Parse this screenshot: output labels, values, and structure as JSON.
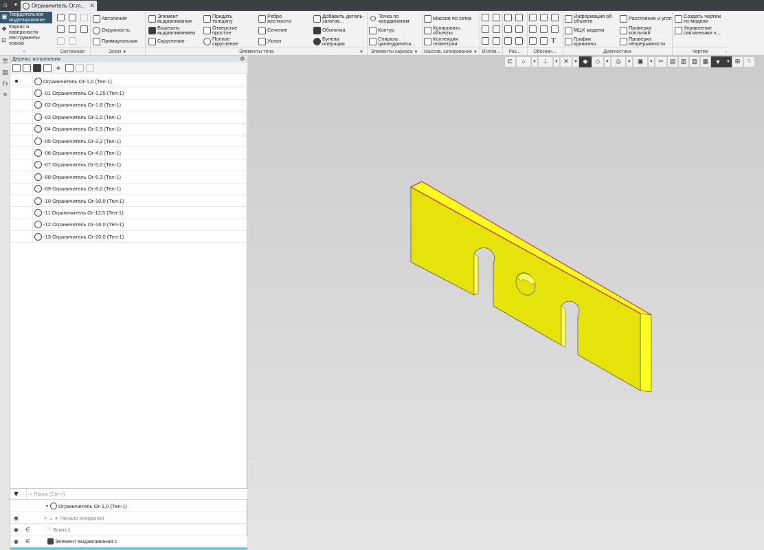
{
  "tab_bar": {
    "home_icon": "home-icon",
    "document_tab": {
      "title": "Ограничитель Ог.m...",
      "close": "✕"
    }
  },
  "ribbon": {
    "modes": [
      {
        "label": "Твердотельное моделирование",
        "icon": "solid-modeling-icon",
        "active": true
      },
      {
        "label": "Каркас и поверхности",
        "icon": "wireframe-icon",
        "active": false
      },
      {
        "label": "Инструменты эскиза",
        "icon": "sketch-tools-icon",
        "active": false
      }
    ],
    "groups": {
      "system": "Системная",
      "sketch": "Эскиз",
      "body_elements": "Элементы тела",
      "frame_elements": "Элементы каркаса",
      "arrays": "Массив, копирование",
      "aux": "Вспом...",
      "sizes": "Раз...",
      "designations": "Обознач...",
      "diagnostics": "Диагностика",
      "drawing": "Чертеж"
    },
    "sketch_buttons": [
      "Автолиния",
      "Окружность",
      "Прямоугольник"
    ],
    "body_buttons": [
      "Элемент выдавливания",
      "Вырезать выдавливанием",
      "Скругление",
      "Придать толщину",
      "Отверстие простое",
      "Полное скругление",
      "Ребро жесткости",
      "Сечение",
      "Уклон",
      "Добавить деталь-заготов...",
      "Оболочка",
      "Булева операция"
    ],
    "frame_buttons": [
      "Точка по координатам",
      "Контур",
      "Спираль цилиндрическ..."
    ],
    "array_buttons": [
      "Массив по сетке",
      "Копировать объекты",
      "Коллекция геометрии"
    ],
    "diagnostic_buttons": [
      "Информация об объекте",
      "МЦХ модели",
      "График кривизны",
      "Расстояние и угол",
      "Проверка коллизий",
      "Проверка непрерывности"
    ],
    "drawing_buttons": [
      "Создать чертеж по модели",
      "Управление связанными ч..."
    ]
  },
  "panel": {
    "title": "Дерево: исполнения",
    "search_placeholder": "Поиск (Ctrl+/)",
    "variants": [
      {
        "label": "Ограничитель Ог-1,0 (Тел-1)",
        "current": true
      },
      {
        "label": "-01 Ограничитель Ог-1,25 (Тел-1)",
        "current": false
      },
      {
        "label": "-02 Ограничитель Ог-1,6 (Тел-1)",
        "current": false
      },
      {
        "label": "-03 Ограничитель Ог-2,0 (Тел-1)",
        "current": false
      },
      {
        "label": "-04 Ограничитель Ог-2,5 (Тел-1)",
        "current": false
      },
      {
        "label": "-05 Ограничитель Ог-3,2 (Тел-1)",
        "current": false
      },
      {
        "label": "-06 Ограничитель Ог-4,0 (Тел-1)",
        "current": false
      },
      {
        "label": "-07 Ограничитель Ог-5,0 (Тел-1)",
        "current": false
      },
      {
        "label": "-08 Ограничитель Ог-6,3 (Тел-1)",
        "current": false
      },
      {
        "label": "-09 Ограничитель Ог-8,0 (Тел-1)",
        "current": false
      },
      {
        "label": "-10 Ограничитель Ог-10,0 (Тел-1)",
        "current": false
      },
      {
        "label": "-11 Ограничитель Ог-12,5 (Тел-1)",
        "current": false
      },
      {
        "label": "-12 Ограничитель Ог-16,0 (Тел-1)",
        "current": false
      },
      {
        "label": "-13 Ограничитель Ог-20,0 (Тел-1)",
        "current": false
      }
    ],
    "model_tree": [
      {
        "label": "Ограничитель Ог-1,0 (Тел-1)",
        "icon": "part-icon",
        "eye": false,
        "eps": false
      },
      {
        "label": "Начало координат",
        "icon": "origin-icon",
        "eye": true,
        "eps": false
      },
      {
        "label": "Эскиз:1",
        "icon": "sketch-icon",
        "eye": true,
        "eps": true
      },
      {
        "label": "Элемент выдавливания:1",
        "icon": "extrude-icon",
        "eye": true,
        "eps": true
      }
    ]
  },
  "viewport": {
    "part_color": "#f2f000",
    "side_color": "#ffff1e",
    "edge_color": "#cc1b1b",
    "background_top": "#cbcbcb",
    "background_bottom": "#e4e4e4"
  }
}
